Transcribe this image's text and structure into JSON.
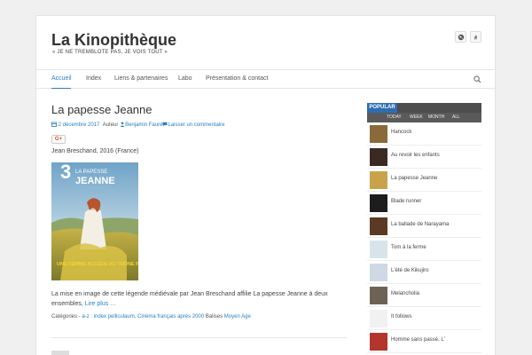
{
  "site": {
    "title": "La Kinopithèque",
    "description": "« JE NE TREMBLOTE PAS, JE VOIS TOUT »",
    "social": [
      "globe-icon",
      "pin-icon"
    ]
  },
  "nav": {
    "items": [
      {
        "label": "Accueil",
        "active": true
      },
      {
        "label": "Index"
      },
      {
        "label": "Liens & partenaires"
      },
      {
        "label": "Labo"
      },
      {
        "label": "Présentation & contact"
      }
    ]
  },
  "post": {
    "title": "La papesse Jeanne",
    "date": "2 décembre 2017",
    "author_prefix": "Auteur",
    "author": "Benjamin Fauré",
    "comments": "Laisser un commentaire",
    "gplus": "G+",
    "subtitle": "Jean Breschand, 2016 (France)",
    "excerpt": "La mise en image de cette légende médiévale par Jean Breschand affilie La papesse Jeanne à deux ensembles,",
    "read_more": "Lire plus …",
    "categories_label": "Catégories -",
    "categories": "a-z : index pelliculaum, Cinéma français après 2000",
    "tags_label": "Balises",
    "tags": "Moyen Age",
    "poster": {
      "number": "3",
      "top_text": "LA PAPESSE",
      "name": "JEANNE",
      "tagline": "UNE FEMME ACCÈDE AU TRÔNE PAPAL ?"
    }
  },
  "sidebar": {
    "popular_label": "POPULAR",
    "tabs": [
      "TODAY",
      "WEEK",
      "MONTH",
      "ALL"
    ],
    "items": [
      {
        "title": "Hancock",
        "color": "#8a6a3a"
      },
      {
        "title": "Au revoir les enfants",
        "color": "#3a2a22"
      },
      {
        "title": "La papesse Jeanne",
        "color": "#c9a34a"
      },
      {
        "title": "Blade runner",
        "color": "#1d1d1d"
      },
      {
        "title": "La ballade de Narayama",
        "color": "#5a3a22"
      },
      {
        "title": "Tom à la ferme",
        "color": "#d9e4ea"
      },
      {
        "title": "L'été de Kikujiro",
        "color": "#cfd9e6"
      },
      {
        "title": "Melancholia",
        "color": "#6e6255"
      },
      {
        "title": "It follows",
        "color": "#f1f1f1"
      },
      {
        "title": "Homme sans passé, L'",
        "color": "#b2362b"
      }
    ]
  }
}
